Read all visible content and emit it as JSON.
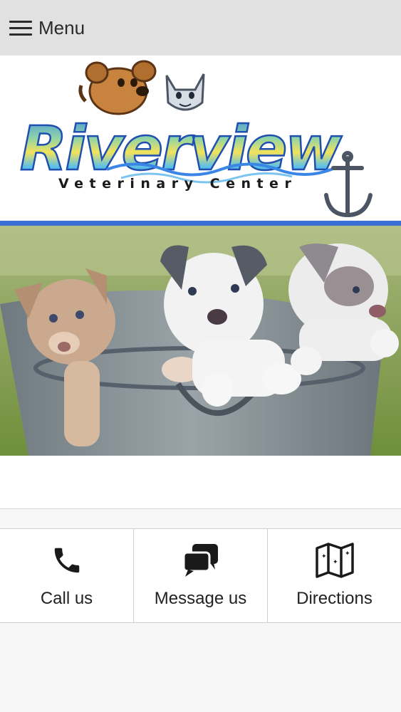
{
  "header": {
    "menu_label": "Menu",
    "menu_icon": "hamburger-icon"
  },
  "logo": {
    "title": "Riverview",
    "subtitle": "Veterinary Center",
    "anchor_icon": "anchor-icon"
  },
  "colors": {
    "header_bg": "#e1e1e1",
    "accent_blue": "#3a6fd8",
    "action_border": "#cfcfcf"
  },
  "actions": [
    {
      "label": "Call us",
      "icon": "phone-icon"
    },
    {
      "label": "Message us",
      "icon": "chat-bubbles-icon"
    },
    {
      "label": "Directions",
      "icon": "map-icon"
    }
  ]
}
